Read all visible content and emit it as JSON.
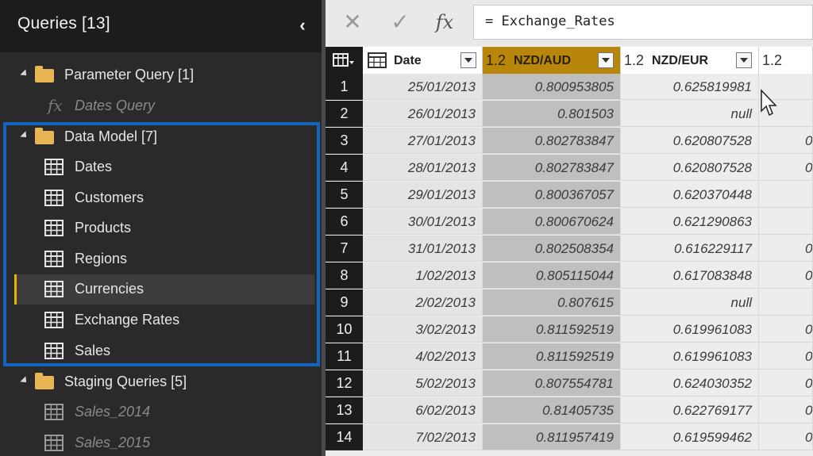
{
  "queries_pane": {
    "title": "Queries [13]",
    "collapse_glyph": "‹",
    "groups": [
      {
        "label": "Parameter Query [1]",
        "items": [
          {
            "label": "Dates Query",
            "icon": "fx-icon"
          }
        ]
      },
      {
        "label": "Data Model [7]",
        "items": [
          {
            "label": "Dates",
            "icon": "table-icon"
          },
          {
            "label": "Customers",
            "icon": "table-icon"
          },
          {
            "label": "Products",
            "icon": "table-icon"
          },
          {
            "label": "Regions",
            "icon": "table-icon"
          },
          {
            "label": "Currencies",
            "icon": "table-icon"
          },
          {
            "label": "Exchange Rates",
            "icon": "table-icon"
          },
          {
            "label": "Sales",
            "icon": "table-icon"
          }
        ]
      },
      {
        "label": "Staging Queries [5]",
        "items": [
          {
            "label": "Sales_2014",
            "icon": "table-icon"
          },
          {
            "label": "Sales_2015",
            "icon": "table-icon"
          }
        ]
      }
    ],
    "selected_item": "Currencies"
  },
  "formula_bar": {
    "cancel_glyph": "✕",
    "commit_glyph": "✓",
    "fx_glyph": "fx",
    "formula": "= Exchange_Rates"
  },
  "grid": {
    "columns": [
      {
        "type": "",
        "name": "Date"
      },
      {
        "type": "1.2",
        "name": "NZD/AUD"
      },
      {
        "type": "1.2",
        "name": "NZD/EUR"
      },
      {
        "type": "1.2",
        "name": ""
      }
    ],
    "rows": [
      {
        "n": "1",
        "date": "25/01/2013",
        "aud": "0.800953805",
        "eur": "0.625819981",
        "extra": ""
      },
      {
        "n": "2",
        "date": "26/01/2013",
        "aud": "0.801503",
        "eur": "null",
        "extra": ""
      },
      {
        "n": "3",
        "date": "27/01/2013",
        "aud": "0.802783847",
        "eur": "0.620807528",
        "extra": "0"
      },
      {
        "n": "4",
        "date": "28/01/2013",
        "aud": "0.802783847",
        "eur": "0.620807528",
        "extra": "0"
      },
      {
        "n": "5",
        "date": "29/01/2013",
        "aud": "0.800367057",
        "eur": "0.620370448",
        "extra": ""
      },
      {
        "n": "6",
        "date": "30/01/2013",
        "aud": "0.800670624",
        "eur": "0.621290863",
        "extra": ""
      },
      {
        "n": "7",
        "date": "31/01/2013",
        "aud": "0.802508354",
        "eur": "0.616229117",
        "extra": "0"
      },
      {
        "n": "8",
        "date": "1/02/2013",
        "aud": "0.805115044",
        "eur": "0.617083848",
        "extra": "0"
      },
      {
        "n": "9",
        "date": "2/02/2013",
        "aud": "0.807615",
        "eur": "null",
        "extra": ""
      },
      {
        "n": "10",
        "date": "3/02/2013",
        "aud": "0.811592519",
        "eur": "0.619961083",
        "extra": "0"
      },
      {
        "n": "11",
        "date": "4/02/2013",
        "aud": "0.811592519",
        "eur": "0.619961083",
        "extra": "0"
      },
      {
        "n": "12",
        "date": "5/02/2013",
        "aud": "0.807554781",
        "eur": "0.624030352",
        "extra": "0"
      },
      {
        "n": "13",
        "date": "6/02/2013",
        "aud": "0.81405735",
        "eur": "0.622769177",
        "extra": "0"
      },
      {
        "n": "14",
        "date": "7/02/2013",
        "aud": "0.811957419",
        "eur": "0.619599462",
        "extra": "0"
      }
    ]
  },
  "colors": {
    "accent": "#e8b400",
    "highlight_box": "#1565c0",
    "selected_column": "#b8860b"
  }
}
